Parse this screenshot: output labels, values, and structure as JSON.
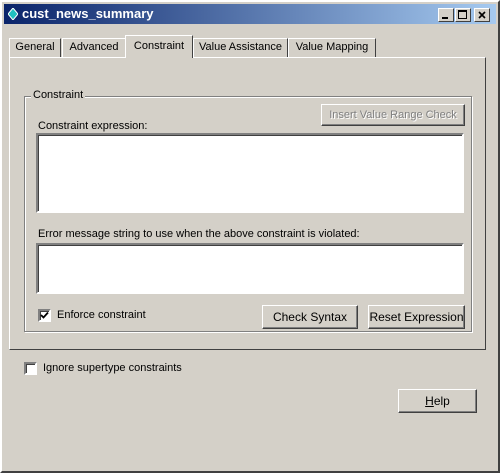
{
  "window": {
    "title": "cust_news_summary",
    "controls": {
      "minimize": "minimize",
      "maximize": "maximize",
      "close": "close"
    }
  },
  "tabs": [
    {
      "label": "General",
      "active": false
    },
    {
      "label": "Advanced",
      "active": false
    },
    {
      "label": "Constraint",
      "active": true
    },
    {
      "label": "Value Assistance",
      "active": false
    },
    {
      "label": "Value Mapping",
      "active": false
    }
  ],
  "constraint_group": {
    "title": "Constraint",
    "insert_range_button": "Insert Value Range Check",
    "expression_label": "Constraint expression:",
    "expression_value": "",
    "error_label": "Error message string to use when the above constraint is violated:",
    "error_value": "",
    "enforce_label": "Enforce constraint",
    "enforce_checked": true,
    "check_syntax_button": "Check Syntax",
    "reset_expression_button": "Reset Expression"
  },
  "ignore_supertype": {
    "label": "Ignore supertype constraints",
    "checked": false
  },
  "help_button": {
    "prefix": "H",
    "rest": "elp"
  },
  "icons": {
    "title": "app-diamond-icon",
    "check": "checkmark-icon"
  },
  "colors": {
    "titlebar_start": "#0a246a",
    "titlebar_end": "#a6caf0",
    "face": "#d4d0c8"
  }
}
